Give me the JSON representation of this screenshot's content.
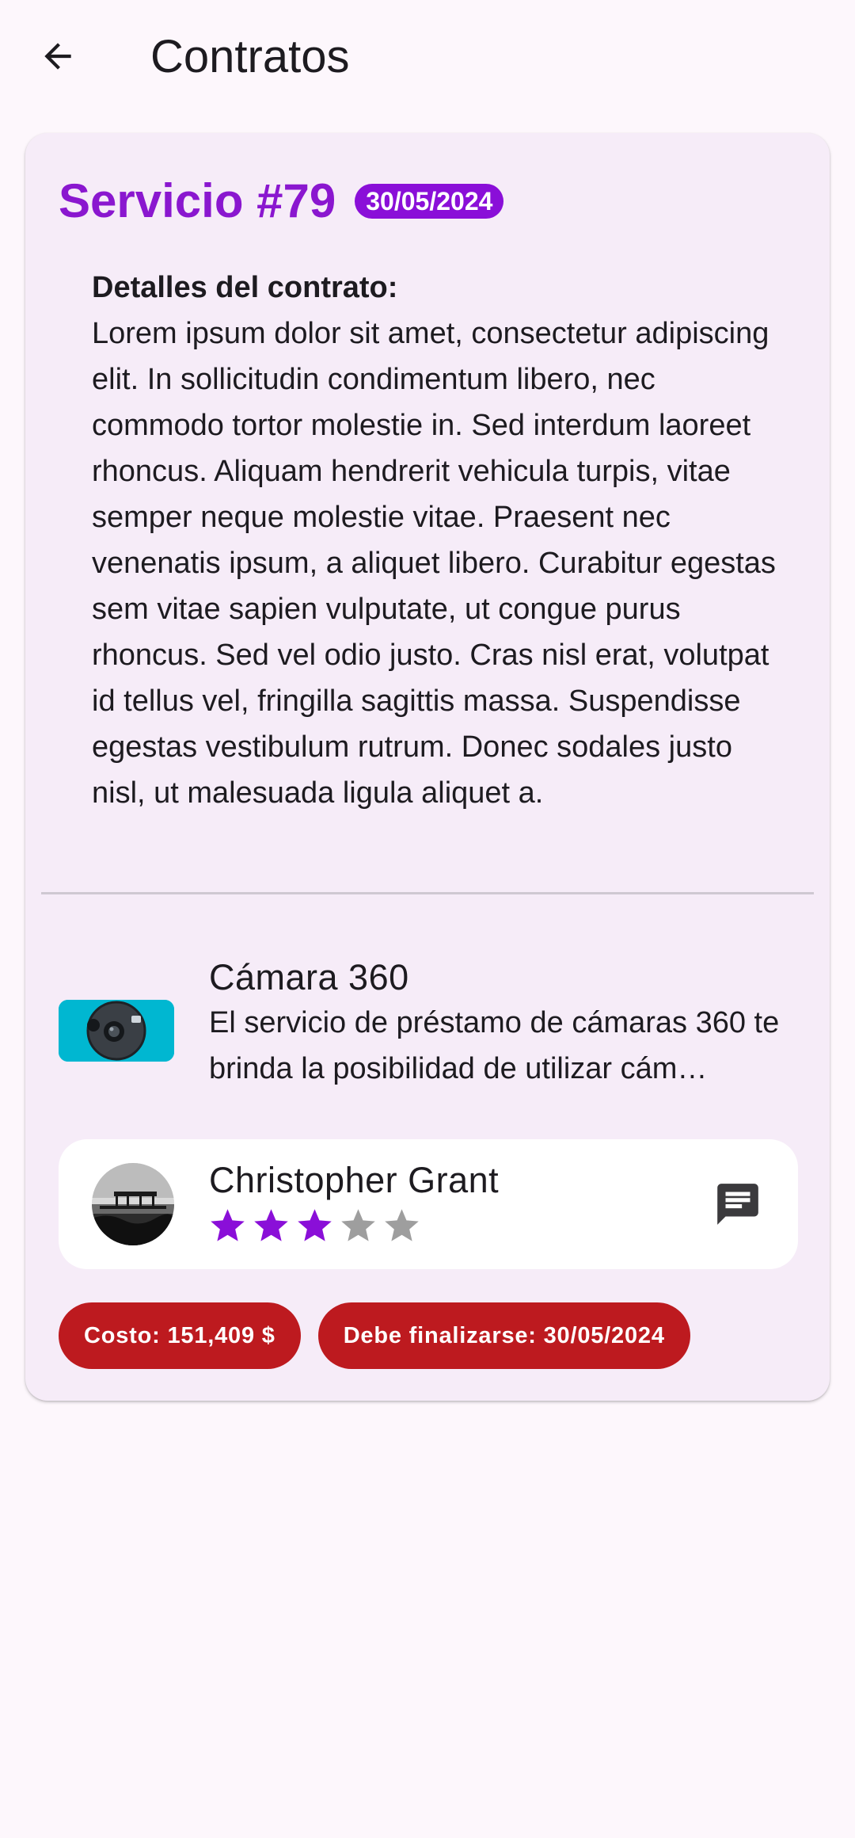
{
  "app_bar": {
    "title": "Contratos",
    "back_icon": "arrow-back-icon"
  },
  "service": {
    "title": "Servicio #79",
    "date_badge": "30/05/2024",
    "details_heading": "Detalles del contrato:",
    "details_text": "Lorem ipsum dolor sit amet, consectetur adipiscing elit. In sollicitudin condimentum libero, nec commodo tortor molestie in. Sed interdum laoreet rhoncus. Aliquam hendrerit vehicula turpis, vitae semper neque molestie vitae. Praesent nec venenatis ipsum, a aliquet libero. Curabitur egestas sem vitae sapien vulputate, ut congue purus rhoncus. Sed vel odio justo. Cras nisl erat, volutpat id tellus vel, fringilla sagittis massa. Suspendisse egestas vestibulum rutrum. Donec sodales justo nisl, ut malesuada ligula aliquet a."
  },
  "item": {
    "name": "Cámara 360",
    "description": "El servicio de préstamo de cámaras 360 te brinda la posibilidad de utilizar cám…"
  },
  "provider": {
    "name": "Christopher Grant",
    "rating": 3,
    "rating_max": 5,
    "chat_icon": "chat-icon"
  },
  "chips": {
    "cost": "Costo: 151,409 $",
    "deadline": "Debe finalizarse: 30/05/2024"
  },
  "colors": {
    "accent": "#8a17cf",
    "chip": "#bd1a1f",
    "card_bg": "#f6ecf8",
    "page_bg": "#fdf7fc",
    "star_on": "#8a0fd8",
    "star_off": "#9e9e9e"
  }
}
